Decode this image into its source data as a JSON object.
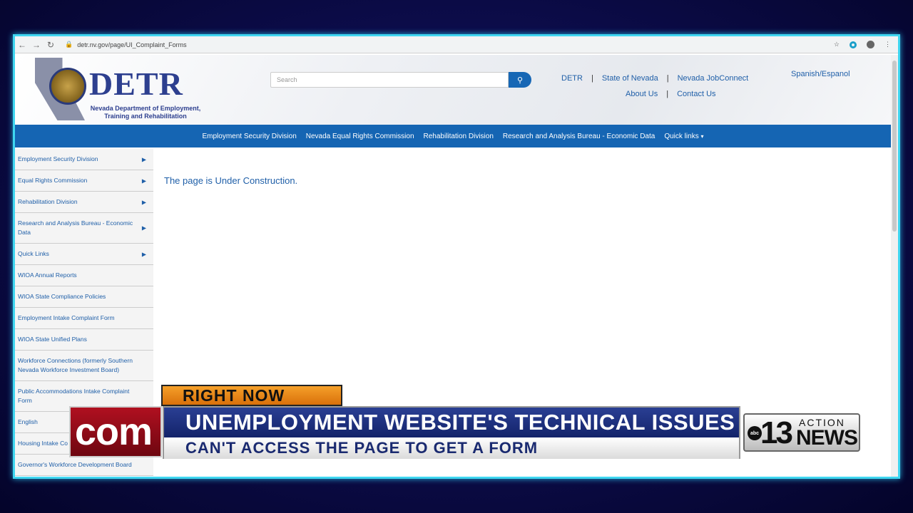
{
  "browser": {
    "url": "detr.nv.gov/page/UI_Complaint_Forms"
  },
  "header": {
    "logo_text": "DETR",
    "logo_subtitle_1": "Nevada Department of Employment,",
    "logo_subtitle_2": "Training and Rehabilitation",
    "search_placeholder": "Search",
    "links_row1": [
      "DETR",
      "State of Nevada",
      "Nevada JobConnect"
    ],
    "links_row2": [
      "About Us",
      "Contact Us"
    ],
    "language_link": "Spanish/Espanol"
  },
  "main_nav": {
    "items": [
      "Employment Security Division",
      "Nevada Equal Rights Commission",
      "Rehabilitation Division",
      "Research and Analysis Bureau - Economic Data",
      "Quick links"
    ]
  },
  "sidebar": {
    "items": [
      {
        "label": "Employment Security Division",
        "arrow": true
      },
      {
        "label": "Equal Rights Commission",
        "arrow": true
      },
      {
        "label": "Rehabilitation Division",
        "arrow": true
      },
      {
        "label": "Research and Analysis Bureau - Economic Data",
        "arrow": true
      },
      {
        "label": "Quick Links",
        "arrow": true
      },
      {
        "label": "WIOA Annual Reports",
        "arrow": false
      },
      {
        "label": "WIOA State Compliance Policies",
        "arrow": false
      },
      {
        "label": "Employment Intake Complaint Form",
        "arrow": false
      },
      {
        "label": "WIOA State Unified Plans",
        "arrow": false
      },
      {
        "label": "Workforce Connections (formerly Southern Nevada Workforce Investment Board)",
        "arrow": false
      },
      {
        "label": "Public Accommodations Intake Complaint Form",
        "arrow": false
      },
      {
        "label": "English",
        "arrow": false
      },
      {
        "label": "Housing Intake Co",
        "arrow": false
      },
      {
        "label": "Governor's Workforce Development Board",
        "arrow": false
      }
    ]
  },
  "content": {
    "message": "The page is Under Construction."
  },
  "news_overlay": {
    "tag": "RIGHT NOW",
    "com": "com",
    "headline": "UNEMPLOYMENT WEBSITE'S TECHNICAL ISSUES",
    "subline": "CAN'T ACCESS THE PAGE TO GET A FORM",
    "station_number": "13",
    "station_action": "ACTION",
    "station_news": "NEWS",
    "network": "abc"
  },
  "colors": {
    "nav_blue": "#1565b3",
    "link_blue": "#1f5fa8",
    "frame_cyan": "#3fd6f0",
    "tag_orange": "#f5a02a"
  }
}
